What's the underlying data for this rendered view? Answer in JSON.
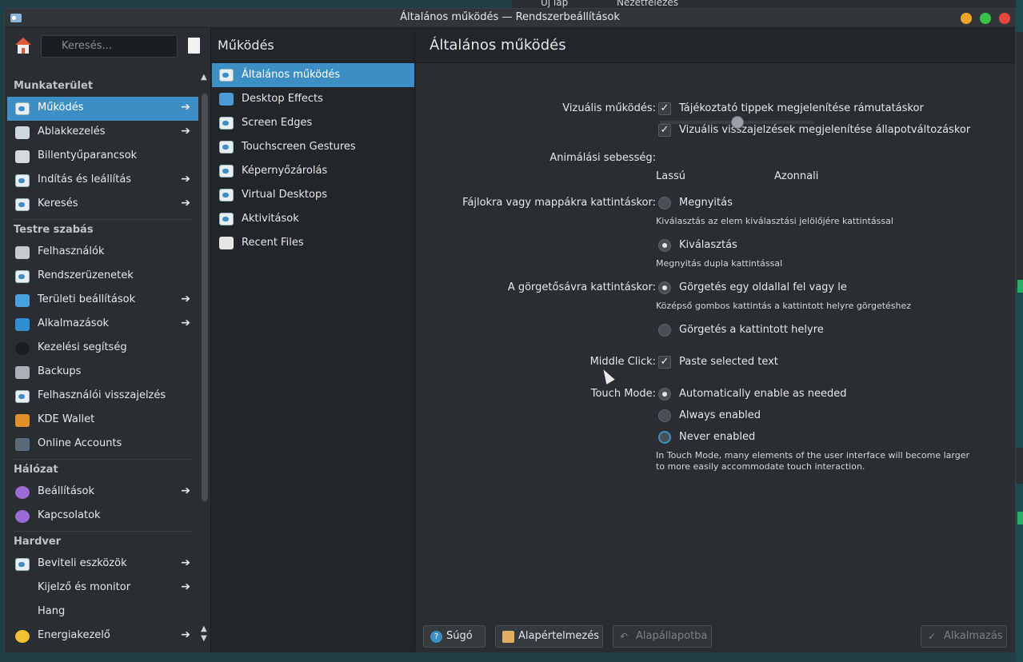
{
  "background": {
    "top_labels": [
      "Új lap",
      "Nézetfelezés"
    ]
  },
  "window": {
    "title": "Általános működés — Rendszerbeállítások"
  },
  "sidebar": {
    "search_placeholder": "Keresés...",
    "sections": [
      {
        "title": "Munkaterület",
        "items": [
          {
            "label": "Működés",
            "arrow": true,
            "selected": true,
            "icon": "toggle-icon"
          },
          {
            "label": "Ablakkezelés",
            "arrow": true,
            "icon": "window-icon"
          },
          {
            "label": "Billentyűparancsok",
            "arrow": false,
            "icon": "keyboard-icon"
          },
          {
            "label": "Indítás és leállítás",
            "arrow": true,
            "icon": "toggle-icon"
          },
          {
            "label": "Keresés",
            "arrow": true,
            "icon": "toggle-icon"
          }
        ]
      },
      {
        "title": "Testre szabás",
        "items": [
          {
            "label": "Felhasználók",
            "arrow": false,
            "icon": "users-icon"
          },
          {
            "label": "Rendszerüzenetek",
            "arrow": false,
            "icon": "toggle-icon"
          },
          {
            "label": "Területi beállítások",
            "arrow": true,
            "icon": "locale-icon"
          },
          {
            "label": "Alkalmazások",
            "arrow": true,
            "icon": "apps-icon"
          },
          {
            "label": "Kezelési segítség",
            "arrow": false,
            "icon": "accessibility-icon"
          },
          {
            "label": "Backups",
            "arrow": false,
            "icon": "backup-icon"
          },
          {
            "label": "Felhasználói visszajelzés",
            "arrow": false,
            "icon": "toggle-icon"
          },
          {
            "label": "KDE Wallet",
            "arrow": false,
            "icon": "wallet-icon"
          },
          {
            "label": "Online Accounts",
            "arrow": false,
            "icon": "accounts-icon"
          }
        ]
      },
      {
        "title": "Hálózat",
        "items": [
          {
            "label": "Beállítások",
            "arrow": true,
            "icon": "network-icon"
          },
          {
            "label": "Kapcsolatok",
            "arrow": false,
            "icon": "network-icon"
          }
        ]
      },
      {
        "title": "Hardver",
        "items": [
          {
            "label": "Beviteli eszközök",
            "arrow": true,
            "icon": "toggle-icon"
          },
          {
            "label": "Kijelző és monitor",
            "arrow": true,
            "icon": "display-icon"
          },
          {
            "label": "Hang",
            "arrow": false,
            "icon": "audio-icon"
          },
          {
            "label": "Energiakezelő",
            "arrow": true,
            "icon": "power-icon"
          }
        ]
      }
    ]
  },
  "middle": {
    "title": "Működés",
    "items": [
      {
        "label": "Általános működés",
        "selected": true,
        "icon": "toggle-icon"
      },
      {
        "label": "Desktop Effects",
        "icon": "effects-icon"
      },
      {
        "label": "Screen Edges",
        "icon": "toggle-icon"
      },
      {
        "label": "Touchscreen Gestures",
        "icon": "toggle-icon"
      },
      {
        "label": "Képernyőzárolás",
        "icon": "toggle-icon"
      },
      {
        "label": "Virtual Desktops",
        "icon": "toggle-icon"
      },
      {
        "label": "Aktivitások",
        "icon": "toggle-icon"
      },
      {
        "label": "Recent Files",
        "icon": "clock-icon"
      }
    ]
  },
  "content": {
    "title": "Általános működés",
    "visual": {
      "label": "Vizuális működés:",
      "opt1": "Tájékoztató tippek megjelenítése rámutatáskor",
      "opt2": "Vizuális visszajelzések megjelenítése állapotváltozáskor"
    },
    "animation": {
      "label": "Animálási sebesség:",
      "min_label": "Lassú",
      "max_label": "Azonnali",
      "level": 0.5
    },
    "click": {
      "label": "Fájlokra vagy mappákra kattintáskor:",
      "opt1": "Megnyitás",
      "hint1": "Kiválasztás az elem kiválasztási jelölőjére kattintással",
      "opt2": "Kiválasztás",
      "hint2": "Megnyitás dupla kattintással"
    },
    "scrollbar": {
      "label": "A görgetősávra kattintáskor:",
      "opt1": "Görgetés egy oldallal fel vagy le",
      "hint1": "Középső gombos kattintás a kattintott helyre görgetéshez",
      "opt2": "Görgetés a kattintott helyre"
    },
    "middle_click": {
      "label": "Middle Click:",
      "opt1": "Paste selected text"
    },
    "touch": {
      "label": "Touch Mode:",
      "opt1": "Automatically enable as needed",
      "opt2": "Always enabled",
      "opt3": "Never enabled",
      "hint": "In Touch Mode, many elements of the user interface will become larger",
      "hint2": "to more easily accommodate touch interaction."
    },
    "footer": {
      "help": "Súgó",
      "defaults": "Alapértelmezés",
      "reset": "Alapállapotba",
      "apply": "Alkalmazás"
    }
  },
  "colors": {
    "accent": "#3d8ec4",
    "window_bg": "#232629",
    "panel_bg": "#2a2e32"
  }
}
